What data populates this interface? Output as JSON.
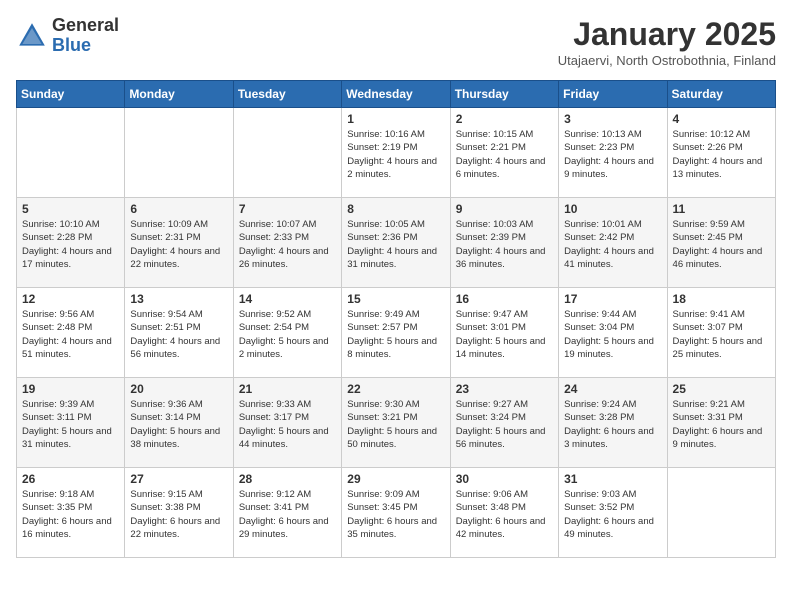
{
  "header": {
    "logo_general": "General",
    "logo_blue": "Blue",
    "month_title": "January 2025",
    "location": "Utajaervi, North Ostrobothnia, Finland"
  },
  "weekdays": [
    "Sunday",
    "Monday",
    "Tuesday",
    "Wednesday",
    "Thursday",
    "Friday",
    "Saturday"
  ],
  "weeks": [
    [
      {
        "day": "",
        "sunrise": "",
        "sunset": "",
        "daylight": ""
      },
      {
        "day": "",
        "sunrise": "",
        "sunset": "",
        "daylight": ""
      },
      {
        "day": "",
        "sunrise": "",
        "sunset": "",
        "daylight": ""
      },
      {
        "day": "1",
        "sunrise": "Sunrise: 10:16 AM",
        "sunset": "Sunset: 2:19 PM",
        "daylight": "Daylight: 4 hours and 2 minutes."
      },
      {
        "day": "2",
        "sunrise": "Sunrise: 10:15 AM",
        "sunset": "Sunset: 2:21 PM",
        "daylight": "Daylight: 4 hours and 6 minutes."
      },
      {
        "day": "3",
        "sunrise": "Sunrise: 10:13 AM",
        "sunset": "Sunset: 2:23 PM",
        "daylight": "Daylight: 4 hours and 9 minutes."
      },
      {
        "day": "4",
        "sunrise": "Sunrise: 10:12 AM",
        "sunset": "Sunset: 2:26 PM",
        "daylight": "Daylight: 4 hours and 13 minutes."
      }
    ],
    [
      {
        "day": "5",
        "sunrise": "Sunrise: 10:10 AM",
        "sunset": "Sunset: 2:28 PM",
        "daylight": "Daylight: 4 hours and 17 minutes."
      },
      {
        "day": "6",
        "sunrise": "Sunrise: 10:09 AM",
        "sunset": "Sunset: 2:31 PM",
        "daylight": "Daylight: 4 hours and 22 minutes."
      },
      {
        "day": "7",
        "sunrise": "Sunrise: 10:07 AM",
        "sunset": "Sunset: 2:33 PM",
        "daylight": "Daylight: 4 hours and 26 minutes."
      },
      {
        "day": "8",
        "sunrise": "Sunrise: 10:05 AM",
        "sunset": "Sunset: 2:36 PM",
        "daylight": "Daylight: 4 hours and 31 minutes."
      },
      {
        "day": "9",
        "sunrise": "Sunrise: 10:03 AM",
        "sunset": "Sunset: 2:39 PM",
        "daylight": "Daylight: 4 hours and 36 minutes."
      },
      {
        "day": "10",
        "sunrise": "Sunrise: 10:01 AM",
        "sunset": "Sunset: 2:42 PM",
        "daylight": "Daylight: 4 hours and 41 minutes."
      },
      {
        "day": "11",
        "sunrise": "Sunrise: 9:59 AM",
        "sunset": "Sunset: 2:45 PM",
        "daylight": "Daylight: 4 hours and 46 minutes."
      }
    ],
    [
      {
        "day": "12",
        "sunrise": "Sunrise: 9:56 AM",
        "sunset": "Sunset: 2:48 PM",
        "daylight": "Daylight: 4 hours and 51 minutes."
      },
      {
        "day": "13",
        "sunrise": "Sunrise: 9:54 AM",
        "sunset": "Sunset: 2:51 PM",
        "daylight": "Daylight: 4 hours and 56 minutes."
      },
      {
        "day": "14",
        "sunrise": "Sunrise: 9:52 AM",
        "sunset": "Sunset: 2:54 PM",
        "daylight": "Daylight: 5 hours and 2 minutes."
      },
      {
        "day": "15",
        "sunrise": "Sunrise: 9:49 AM",
        "sunset": "Sunset: 2:57 PM",
        "daylight": "Daylight: 5 hours and 8 minutes."
      },
      {
        "day": "16",
        "sunrise": "Sunrise: 9:47 AM",
        "sunset": "Sunset: 3:01 PM",
        "daylight": "Daylight: 5 hours and 14 minutes."
      },
      {
        "day": "17",
        "sunrise": "Sunrise: 9:44 AM",
        "sunset": "Sunset: 3:04 PM",
        "daylight": "Daylight: 5 hours and 19 minutes."
      },
      {
        "day": "18",
        "sunrise": "Sunrise: 9:41 AM",
        "sunset": "Sunset: 3:07 PM",
        "daylight": "Daylight: 5 hours and 25 minutes."
      }
    ],
    [
      {
        "day": "19",
        "sunrise": "Sunrise: 9:39 AM",
        "sunset": "Sunset: 3:11 PM",
        "daylight": "Daylight: 5 hours and 31 minutes."
      },
      {
        "day": "20",
        "sunrise": "Sunrise: 9:36 AM",
        "sunset": "Sunset: 3:14 PM",
        "daylight": "Daylight: 5 hours and 38 minutes."
      },
      {
        "day": "21",
        "sunrise": "Sunrise: 9:33 AM",
        "sunset": "Sunset: 3:17 PM",
        "daylight": "Daylight: 5 hours and 44 minutes."
      },
      {
        "day": "22",
        "sunrise": "Sunrise: 9:30 AM",
        "sunset": "Sunset: 3:21 PM",
        "daylight": "Daylight: 5 hours and 50 minutes."
      },
      {
        "day": "23",
        "sunrise": "Sunrise: 9:27 AM",
        "sunset": "Sunset: 3:24 PM",
        "daylight": "Daylight: 5 hours and 56 minutes."
      },
      {
        "day": "24",
        "sunrise": "Sunrise: 9:24 AM",
        "sunset": "Sunset: 3:28 PM",
        "daylight": "Daylight: 6 hours and 3 minutes."
      },
      {
        "day": "25",
        "sunrise": "Sunrise: 9:21 AM",
        "sunset": "Sunset: 3:31 PM",
        "daylight": "Daylight: 6 hours and 9 minutes."
      }
    ],
    [
      {
        "day": "26",
        "sunrise": "Sunrise: 9:18 AM",
        "sunset": "Sunset: 3:35 PM",
        "daylight": "Daylight: 6 hours and 16 minutes."
      },
      {
        "day": "27",
        "sunrise": "Sunrise: 9:15 AM",
        "sunset": "Sunset: 3:38 PM",
        "daylight": "Daylight: 6 hours and 22 minutes."
      },
      {
        "day": "28",
        "sunrise": "Sunrise: 9:12 AM",
        "sunset": "Sunset: 3:41 PM",
        "daylight": "Daylight: 6 hours and 29 minutes."
      },
      {
        "day": "29",
        "sunrise": "Sunrise: 9:09 AM",
        "sunset": "Sunset: 3:45 PM",
        "daylight": "Daylight: 6 hours and 35 minutes."
      },
      {
        "day": "30",
        "sunrise": "Sunrise: 9:06 AM",
        "sunset": "Sunset: 3:48 PM",
        "daylight": "Daylight: 6 hours and 42 minutes."
      },
      {
        "day": "31",
        "sunrise": "Sunrise: 9:03 AM",
        "sunset": "Sunset: 3:52 PM",
        "daylight": "Daylight: 6 hours and 49 minutes."
      },
      {
        "day": "",
        "sunrise": "",
        "sunset": "",
        "daylight": ""
      }
    ]
  ]
}
